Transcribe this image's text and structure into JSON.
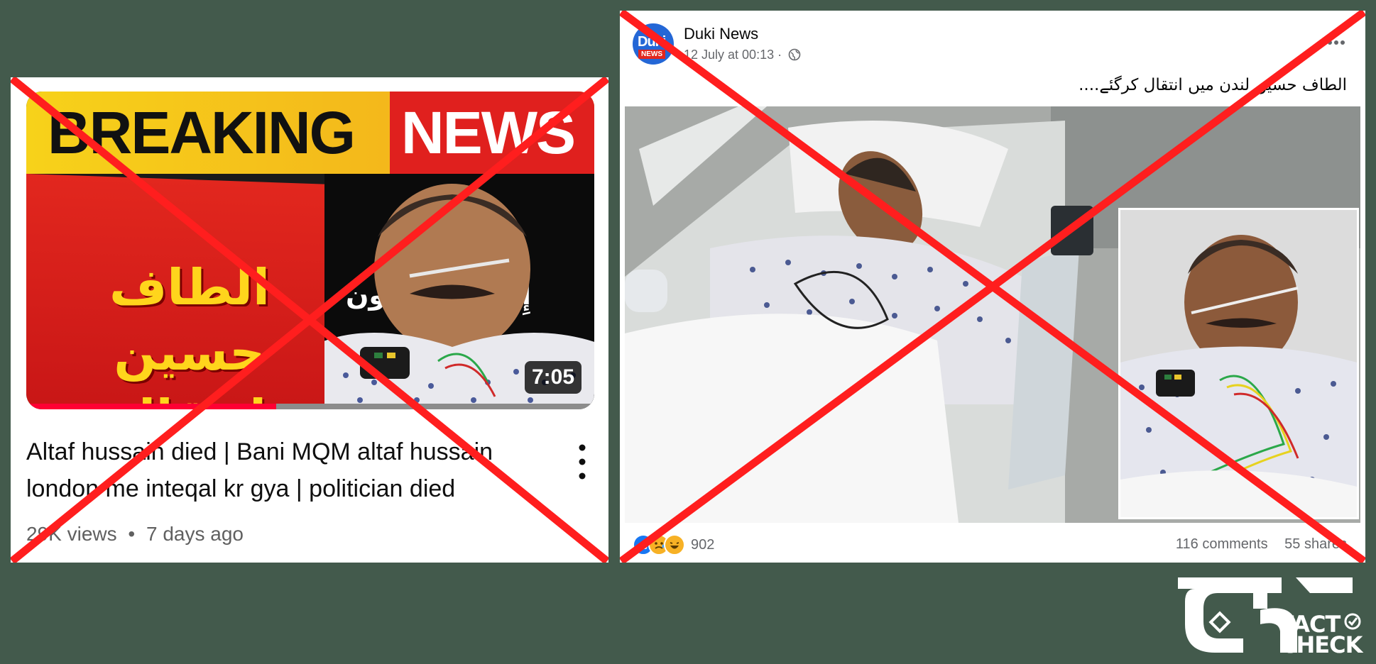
{
  "youtube": {
    "thumbnail": {
      "banner_word1": "BREAKING",
      "banner_word2": "NEWS",
      "urdu_headline": "الطاف حسین انتقال کرگئے",
      "urdu_side": "إِنَّا لِلّٰهِ رَاجِعُون",
      "duration": "7:05",
      "progress_fraction": 0.44
    },
    "title": "Altaf hussain died | Bani MQM altaf hussain london me inteqal kr gya | politician died",
    "views": "29K views",
    "separator": "•",
    "age": "7 days ago",
    "more_icon": "more-vertical-icon"
  },
  "facebook": {
    "page_name": "Duki News",
    "avatar_text_top": "Duki",
    "avatar_text_bottom": "NEWS",
    "timestamp": "12 July at 00:13 ·",
    "audience_icon": "globe-icon",
    "post_text": "الطاف حسین لندن میں انتقال کرگئے....",
    "reaction_count": "902",
    "reactions": [
      "like",
      "sad",
      "haha"
    ],
    "comments": "116 comments",
    "shares": "55 shares"
  },
  "overlay": {
    "mark": "red-x",
    "color": "#ff1e1e"
  },
  "logo": {
    "line1": "FACT",
    "line2": "CHECK"
  },
  "colors": {
    "background": "#435a4c",
    "youtube_progress": "#ff0033",
    "facebook_blue": "#1877f2"
  }
}
